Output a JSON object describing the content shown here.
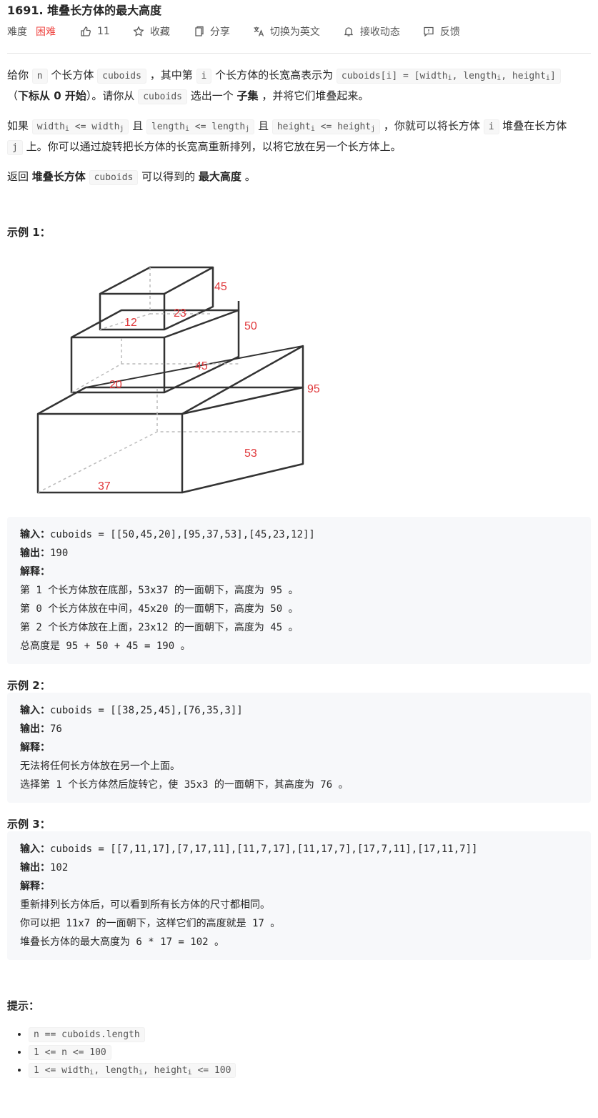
{
  "problem": {
    "title": "1691. 堆叠长方体的最大高度",
    "difficulty_label": "难度",
    "difficulty": "困难",
    "likes": "11",
    "actions": {
      "favorite": "收藏",
      "share": "分享",
      "switch_lang": "切换为英文",
      "notify": "接收动态",
      "feedback": "反馈"
    }
  },
  "description": {
    "p1": {
      "t1": "给你 ",
      "n": "n",
      "t2": " 个长方体 ",
      "cuboids": "cuboids",
      "t3": " ，其中第 ",
      "i": "i",
      "t4": " 个长方体的长宽高表示为 ",
      "formula_prefix": "cuboids[i] = [width",
      "formula_sub1": "i",
      "formula_mid1": ", length",
      "formula_sub2": "i",
      "formula_mid2": ", height",
      "formula_sub3": "i",
      "formula_suffix": "]",
      "t5": "（",
      "bold1": "下标从 0 开始",
      "t6": "）。请你从 ",
      "cuboids2": "cuboids",
      "t7": " 选出一个 ",
      "bold2": "子集",
      "t8": " ，并将它们堆叠起来。"
    },
    "p2": {
      "t1": "如果 ",
      "c1a": "width",
      "c1s": "i",
      "c1b": " <= width",
      "c1s2": "j",
      "t2": " 且 ",
      "c2a": "length",
      "c2s": "i",
      "c2b": " <= length",
      "c2s2": "j",
      "t3": " 且 ",
      "c3a": "height",
      "c3s": "i",
      "c3b": " <= height",
      "c3s2": "j",
      "t4": " ，你就可以将长方体 ",
      "i": "i",
      "t5": " 堆叠在长方体 ",
      "j": "j",
      "t6": " 上。你可以通过旋转把长方体的长宽高重新排列，以将它放在另一个长方体上。"
    },
    "p3": {
      "t1": "返回 ",
      "bold1": "堆叠长方体",
      "cuboids": "cuboids",
      "t2": " 可以得到的 ",
      "bold2": "最大高度",
      "t3": " 。"
    }
  },
  "examples": [
    {
      "title": "示例 1：",
      "input_label": "输入：",
      "input": "cuboids = [[50,45,20],[95,37,53],[45,23,12]]",
      "output_label": "输出：",
      "output": "190",
      "explain_label": "解释：",
      "lines": [
        "第 1 个长方体放在底部，53x37 的一面朝下，高度为 95 。",
        "第 0 个长方体放在中间，45x20 的一面朝下，高度为 50 。",
        "第 2 个长方体放在上面，23x12 的一面朝下，高度为 45 。",
        "总高度是 95 + 50 + 45 = 190 。"
      ]
    },
    {
      "title": "示例 2：",
      "input_label": "输入：",
      "input": "cuboids = [[38,25,45],[76,35,3]]",
      "output_label": "输出：",
      "output": "76",
      "explain_label": "解释：",
      "lines": [
        "无法将任何长方体放在另一个上面。",
        "选择第 1 个长方体然后旋转它，使 35x3 的一面朝下，其高度为 76 。"
      ]
    },
    {
      "title": "示例 3：",
      "input_label": "输入：",
      "input": "cuboids = [[7,11,17],[7,17,11],[11,7,17],[11,17,7],[17,7,11],[17,11,7]]",
      "output_label": "输出：",
      "output": "102",
      "explain_label": "解释：",
      "lines": [
        "重新排列长方体后，可以看到所有长方体的尺寸都相同。",
        "你可以把 11x7 的一面朝下，这样它们的高度就是 17 。",
        "堆叠长方体的最大高度为 6 * 17 = 102 。"
      ]
    }
  ],
  "figure_labels": {
    "top_h": "45",
    "top_l": "23",
    "top_w": "12",
    "mid_h": "50",
    "mid_l": "45",
    "mid_w": "20",
    "bot_h": "95",
    "bot_l": "53",
    "bot_w": "37"
  },
  "hints": {
    "title": "提示：",
    "items": [
      {
        "a": "n == cuboids.length"
      },
      {
        "a": "1 <= n <= 100"
      },
      {
        "a": "1 <= width",
        "s1": "i",
        "b": ", length",
        "s2": "i",
        "c": ", height",
        "s3": "i",
        "d": " <= 100"
      }
    ]
  },
  "colors": {
    "difficulty_hard": "#ef4743",
    "figure_label": "#e0373a",
    "code_bg": "#f7f8fa"
  }
}
